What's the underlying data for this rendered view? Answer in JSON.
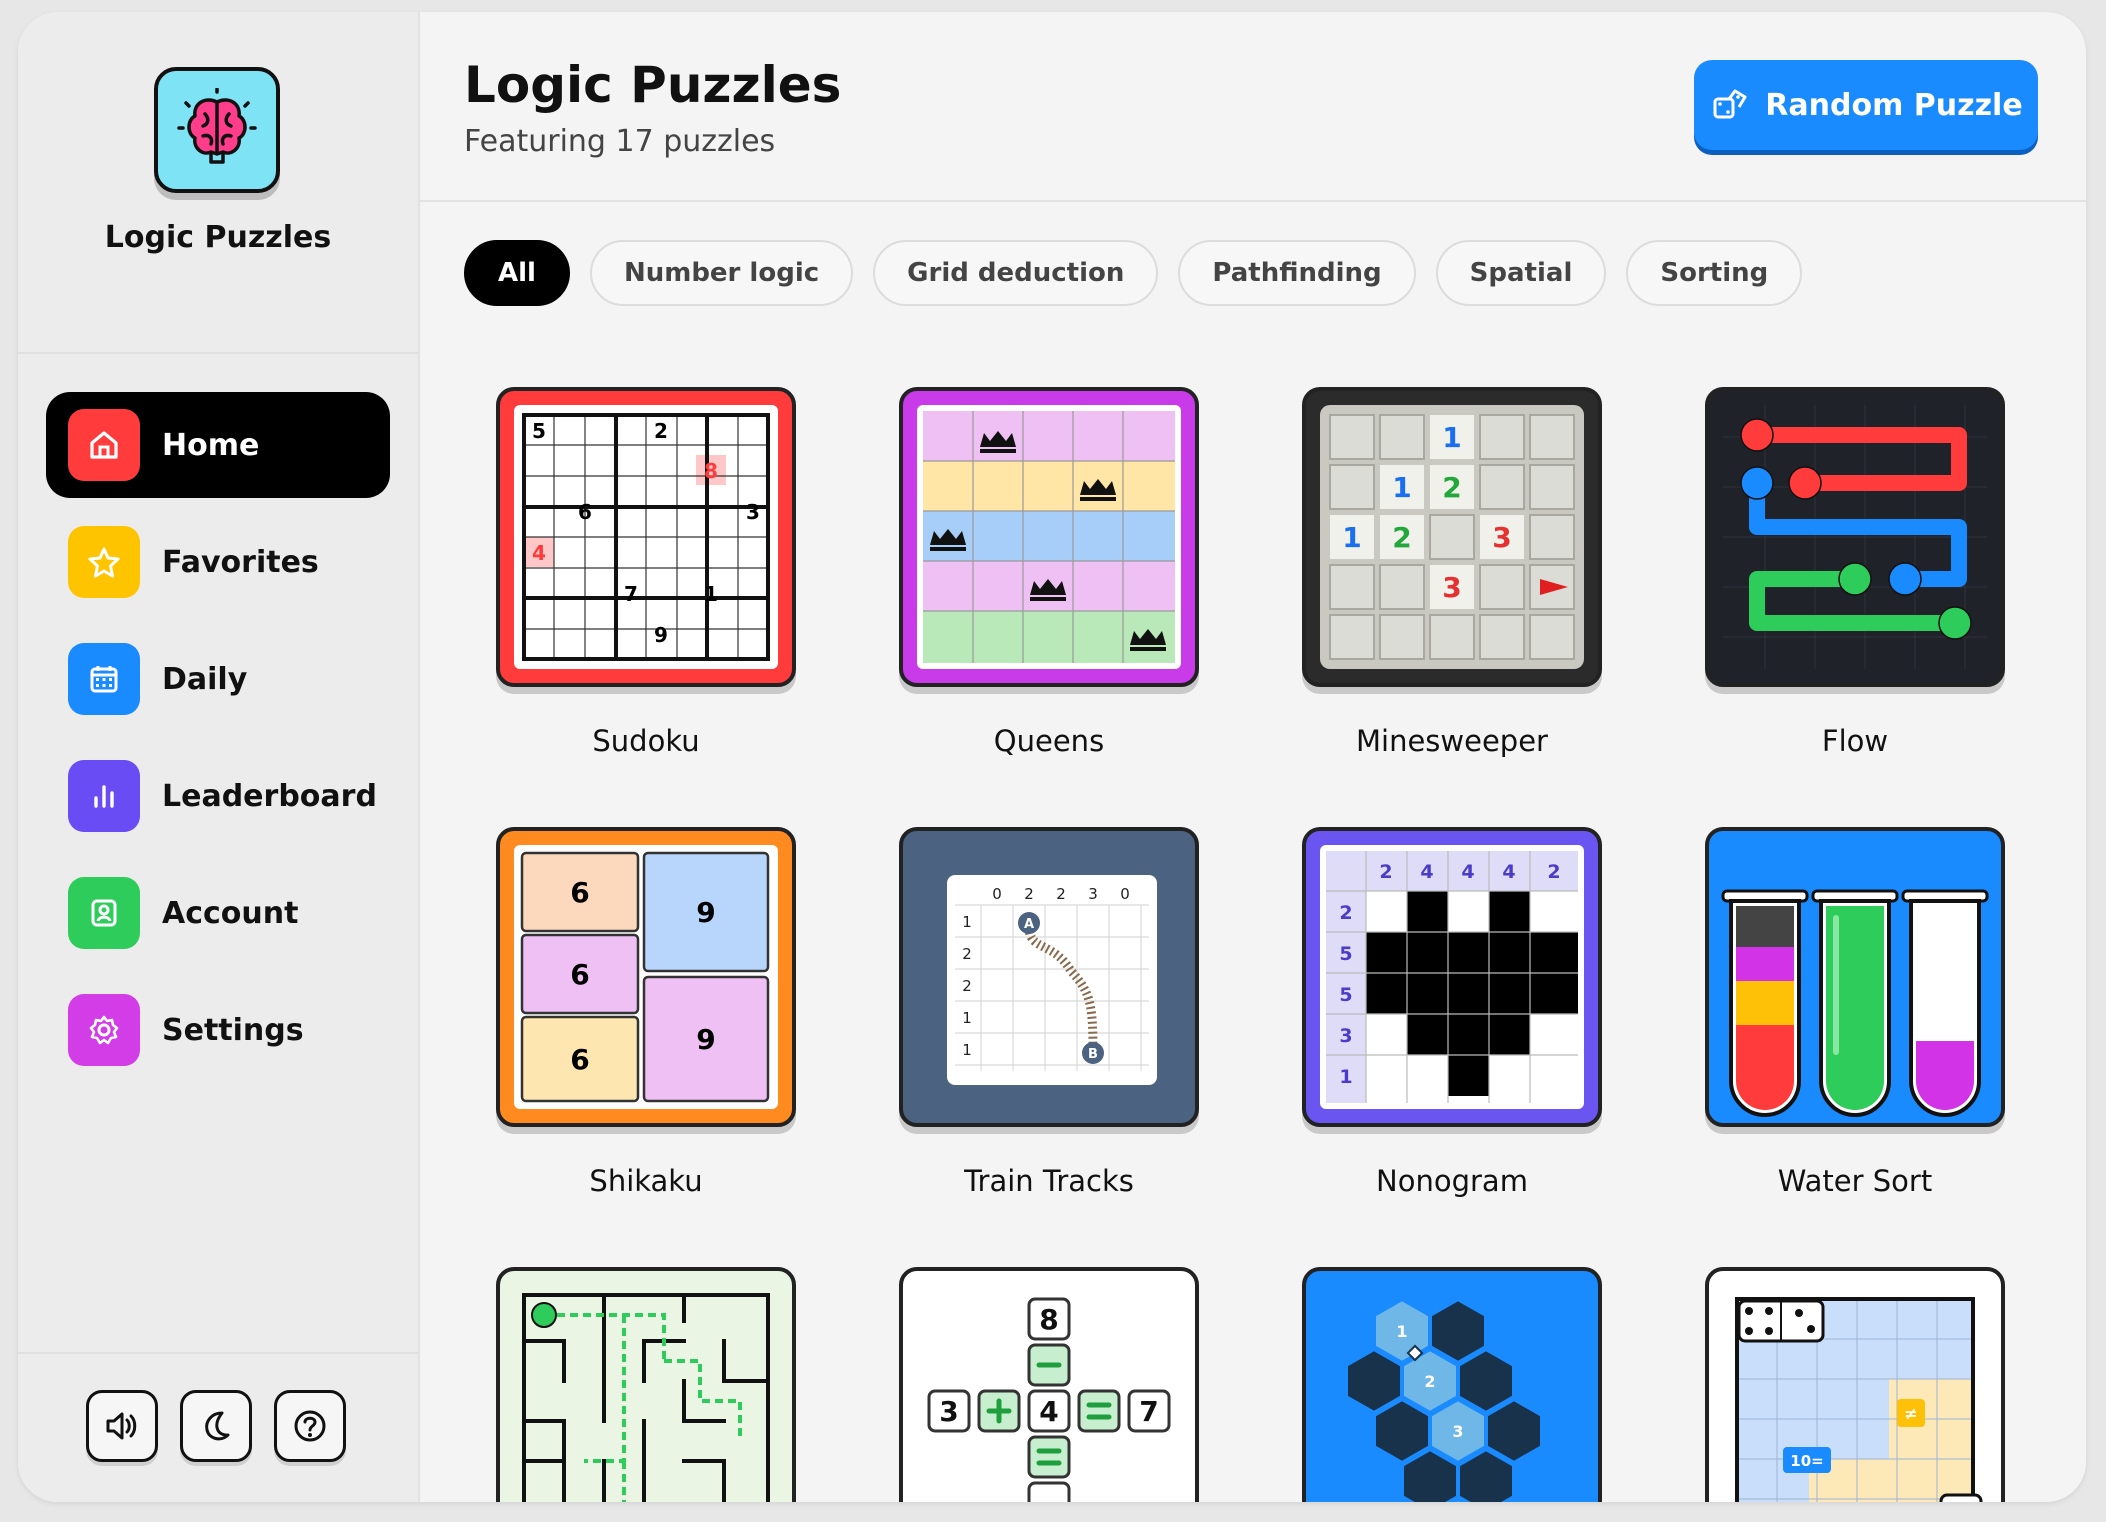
{
  "app": {
    "title": "Logic Puzzles"
  },
  "sidebar": {
    "items": [
      {
        "label": "Home"
      },
      {
        "label": "Favorites"
      },
      {
        "label": "Daily"
      },
      {
        "label": "Leaderboard"
      },
      {
        "label": "Account"
      },
      {
        "label": "Settings"
      }
    ]
  },
  "header": {
    "title": "Logic Puzzles",
    "subtitle": "Featuring 17 puzzles",
    "random_label": "Random Puzzle"
  },
  "filters": [
    "All",
    "Number logic",
    "Grid deduction",
    "Pathfinding",
    "Spatial",
    "Sorting"
  ],
  "puzzles": [
    {
      "name": "Sudoku"
    },
    {
      "name": "Queens"
    },
    {
      "name": "Minesweeper"
    },
    {
      "name": "Flow"
    },
    {
      "name": "Shikaku"
    },
    {
      "name": "Train Tracks"
    },
    {
      "name": "Nonogram"
    },
    {
      "name": "Water Sort"
    }
  ],
  "thumb_text": {
    "sudoku": [
      "5",
      "2",
      "8",
      "6",
      "3",
      "4",
      "7",
      "1",
      "9"
    ],
    "minesweeper": [
      "1",
      "1",
      "2",
      "1",
      "2",
      "3",
      "3"
    ],
    "shikaku": [
      "6",
      "9",
      "6",
      "6",
      "9"
    ],
    "train_cols": [
      "0",
      "2",
      "2",
      "3",
      "0"
    ],
    "train_rows": [
      "1",
      "2",
      "2",
      "1",
      "1"
    ],
    "train_marks": [
      "A",
      "B"
    ],
    "nonogram_cols": [
      "2",
      "4",
      "4",
      "4",
      "2"
    ],
    "nonogram_rows": [
      "2",
      "5",
      "5",
      "3",
      "1"
    ],
    "math": [
      "8",
      "3",
      "4",
      "7"
    ],
    "hex": [
      "1",
      "2",
      "3"
    ],
    "dominosa": [
      "10="
    ]
  },
  "colors": {
    "accent": "#1a8bff",
    "home": "#ff3b3b",
    "favorites": "#ffc400",
    "daily": "#1a8bff",
    "leaderboard": "#6a4cf5",
    "account": "#2ecc5a",
    "settings": "#d23de8"
  }
}
